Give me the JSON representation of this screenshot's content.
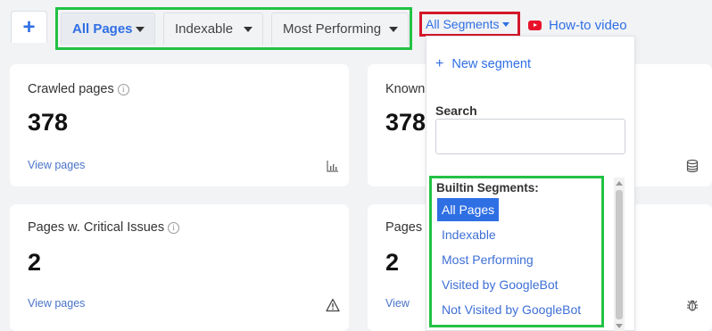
{
  "top_bar": {
    "add_tab_label": "+",
    "tabs": [
      {
        "label": "All Pages",
        "active": true
      },
      {
        "label": "Indexable",
        "active": false
      },
      {
        "label": "Most Performing",
        "active": false
      }
    ],
    "segments_button": "All Segments",
    "howto_link": "How-to video"
  },
  "cards": [
    {
      "title": "Crawled pages",
      "value": "378",
      "link": "View pages",
      "icon": "bar-chart-icon"
    },
    {
      "title": "Known",
      "value": "378",
      "link": "",
      "icon": "database-icon"
    },
    {
      "title": "Pages w. Critical Issues",
      "value": "2",
      "link": "View pages",
      "icon": "warning-icon"
    },
    {
      "title": "Pages",
      "value": "2",
      "link": "View",
      "icon": "bug-icon"
    }
  ],
  "dropdown": {
    "new_segment": "New segment",
    "search_label": "Search",
    "search_value": "",
    "builtin_heading": "Builtin Segments:",
    "builtin_items": [
      "All Pages",
      "Indexable",
      "Most Performing",
      "Visited by GoogleBot",
      "Not Visited by GoogleBot"
    ],
    "selected_index": 0
  },
  "colors": {
    "accent": "#2f6fe4",
    "highlight_green": "#22c244",
    "highlight_red": "#d4172a",
    "background": "#f2f3f5"
  }
}
